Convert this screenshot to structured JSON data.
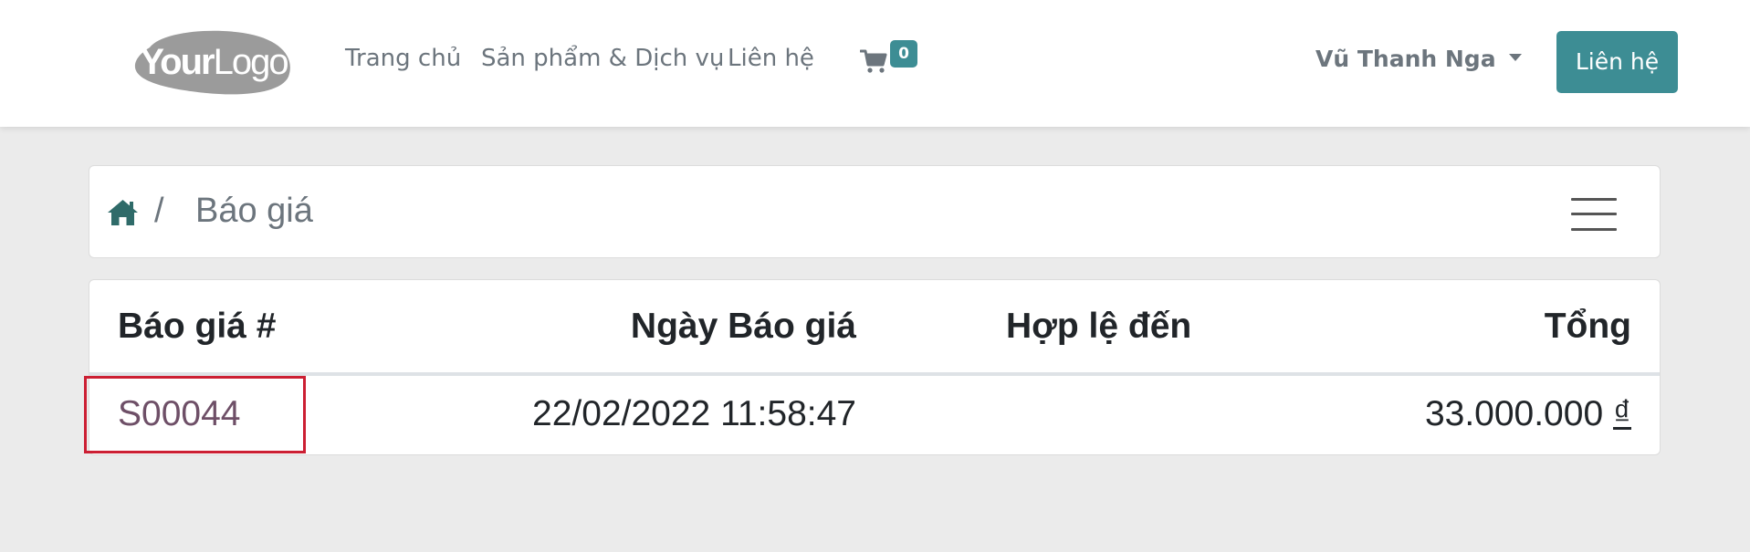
{
  "navbar": {
    "logo": {
      "bold_part": "Your",
      "light_part": "Logo"
    },
    "links": [
      {
        "label": "Trang chủ"
      },
      {
        "label": "Sản phẩm & Dịch vụ"
      },
      {
        "label": "Liên hệ"
      }
    ],
    "cart": {
      "icon": "cart-icon",
      "count": "0"
    },
    "user": {
      "name": "Vũ Thanh Nga"
    },
    "cta_label": "Liên hệ"
  },
  "breadcrumb": {
    "home_icon": "home-icon",
    "separator": "/",
    "current": "Báo giá"
  },
  "quotations": {
    "columns": [
      "Báo giá #",
      "Ngày Báo giá",
      "Hợp lệ đến",
      "Tổng"
    ],
    "rows": [
      {
        "number": "S00044",
        "date": "22/02/2022 11:58:47",
        "valid_until": "",
        "total_amount": "33.000.000",
        "currency": "₫"
      }
    ]
  },
  "colors": {
    "brand_teal": "#3d8d94",
    "page_background": "#ebebeb",
    "link_purple": "#6e4f67",
    "highlight_red": "#cc1f33"
  }
}
